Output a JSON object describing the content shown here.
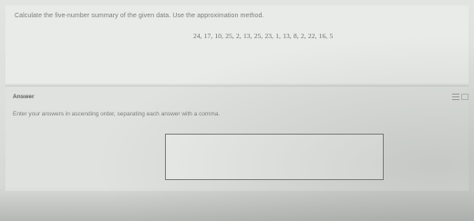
{
  "question": {
    "prompt": "Calculate the five-number summary of the given data. Use the approximation method.",
    "data_values": "24, 17, 10, 25, 2, 13, 25, 23, 1, 13, 8, 2, 22, 16, 5"
  },
  "answer": {
    "heading": "Answer",
    "instruction": "Enter your answers in ascending order, separating each answer with a comma.",
    "input_value": "",
    "input_placeholder": ""
  },
  "tools": {
    "icons": [
      "list-icon",
      "keyboard-icon"
    ]
  }
}
